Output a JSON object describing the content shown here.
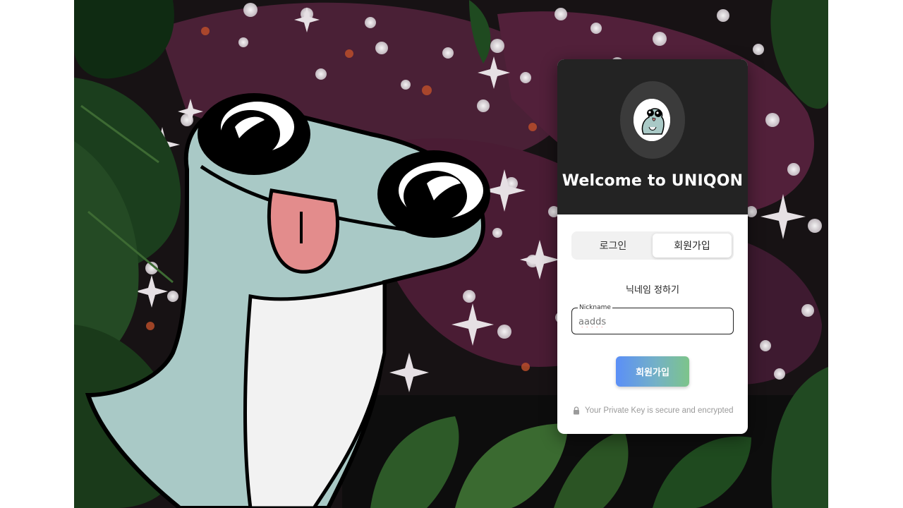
{
  "card": {
    "title": "Welcome to UNIQON",
    "tabs": [
      {
        "label": "로그인",
        "selected": false
      },
      {
        "label": "회원가입",
        "selected": true
      }
    ],
    "section_title": "닉네임 정하기",
    "nickname": {
      "label": "Nickname",
      "value": "aadds"
    },
    "submit_label": "회원가입",
    "security_note": "Your Private Key is secure and encrypted"
  },
  "icons": {
    "avatar": "lizard-avatar-icon",
    "lock": "lock-icon"
  },
  "colors": {
    "header_bg": "#232323",
    "button_gradient_start": "#5b8ff7",
    "button_gradient_end": "#7dc48a",
    "scene_bg": "#1a1416"
  }
}
